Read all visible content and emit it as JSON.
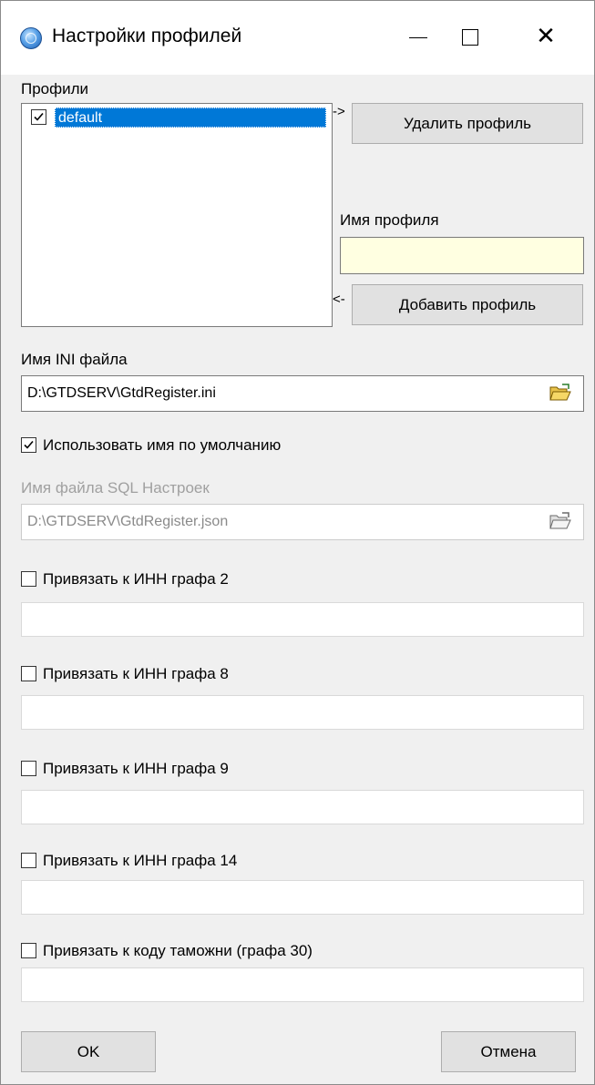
{
  "window": {
    "title": "Настройки профилей",
    "min_icon": "minimize-icon",
    "max_icon": "maximize-icon",
    "close_icon": "close-icon",
    "close_glyph": "✕"
  },
  "profiles": {
    "label": "Профили",
    "items": [
      {
        "label": "default",
        "checked": true,
        "selected": true
      }
    ],
    "arrow_right": "->",
    "arrow_left": "<-",
    "delete_button": "Удалить профиль",
    "name_label": "Имя профиля",
    "name_value": "",
    "add_button": "Добавить профиль"
  },
  "ini": {
    "label": "Имя INI файла",
    "value": "D:\\GTDSERV\\GtdRegister.ini",
    "browse_icon": "folder-open-icon"
  },
  "use_default": {
    "label": "Использовать имя по умолчанию",
    "checked": true
  },
  "sql": {
    "label": "Имя файла SQL Настроек",
    "value": "D:\\GTDSERV\\GtdRegister.json",
    "browse_icon": "folder-open-icon"
  },
  "bindings": [
    {
      "label": "Привязать к ИНН графа 2",
      "checked": false,
      "value": ""
    },
    {
      "label": "Привязать к ИНН графа 8",
      "checked": false,
      "value": ""
    },
    {
      "label": "Привязать к ИНН графа 9",
      "checked": false,
      "value": ""
    },
    {
      "label": "Привязать к ИНН графа 14",
      "checked": false,
      "value": ""
    },
    {
      "label": "Привязать к коду таможни (графа 30)",
      "checked": false,
      "value": ""
    }
  ],
  "buttons": {
    "ok": "OK",
    "cancel": "Отмена"
  },
  "colors": {
    "selection": "#0078d7",
    "name_field_bg": "#ffffe1",
    "window_bg": "#f0f0f0"
  }
}
